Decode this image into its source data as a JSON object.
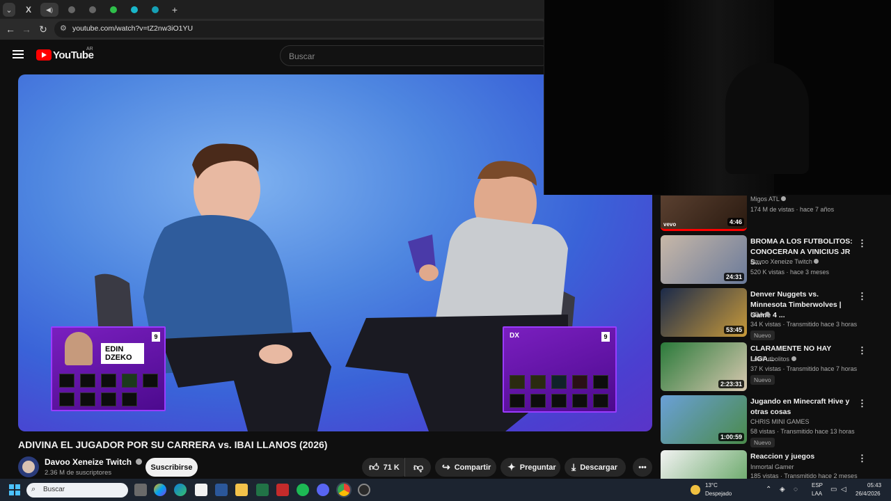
{
  "browser": {
    "tabs": [
      {
        "icon": "chevron-down-icon",
        "label": "⌄"
      },
      {
        "icon": "x-logo-icon",
        "label": "X"
      },
      {
        "icon": "speaker-icon",
        "label": "◀)"
      },
      {
        "icon": "globe-icon",
        "label": ""
      },
      {
        "icon": "globe-icon",
        "label": ""
      },
      {
        "icon": "extension-icon",
        "label": ""
      },
      {
        "icon": "tab-icon",
        "label": ""
      },
      {
        "icon": "tab-icon",
        "label": ""
      }
    ],
    "new_tab_label": "+",
    "url": "youtube.com/watch?v=tZ2nw3iO1YU"
  },
  "youtube": {
    "logo_text": "YouTube",
    "country": "AR",
    "search_placeholder": "Buscar"
  },
  "video": {
    "card_left": {
      "name_line1": "EDIN",
      "name_line2": "DZEKO",
      "score": "9"
    },
    "card_right": {
      "name": "DX",
      "score": "9"
    },
    "title": "ADIVINA EL JUGADOR POR SU CARRERA vs. IBAI LLANOS (2026)",
    "channel": "Davoo Xeneize Twitch",
    "subscribers": "2.36 M de suscriptores",
    "subscribe_label": "Suscribirse",
    "likes": "71 K",
    "share_label": "Compartir",
    "ask_label": "Preguntar",
    "download_label": "Descargar"
  },
  "related": [
    {
      "title": "",
      "channel": "Migos ATL",
      "verified": true,
      "meta": "174 M de vistas · hace 7 años",
      "duration": "4:46",
      "badge": ""
    },
    {
      "title": "BROMA A LOS FUTBOLITOS: CONOCERAN A VINICIUS JR S...",
      "channel": "Davoo Xeneize Twitch",
      "verified": true,
      "meta": "520 K vistas · hace 3 meses",
      "duration": "24:31",
      "badge": ""
    },
    {
      "title": "Denver Nuggets vs. Minnesota Timberwolves | Game 4 ...",
      "channel": "NBA",
      "verified": true,
      "meta": "34 K vistas · Transmitido hace 3 horas",
      "duration": "53:45",
      "badge": "Nuevo"
    },
    {
      "title": "CLARAMENTE NO HAY LIGA...",
      "channel": "Los Futbolitos",
      "verified": true,
      "meta": "37 K vistas · Transmitido hace 7 horas",
      "duration": "2:23:31",
      "badge": "Nuevo"
    },
    {
      "title": "Jugando en Minecraft Hive y otras cosas",
      "channel": "CHRIS MINI GAMES",
      "verified": false,
      "meta": "58 vistas · Transmitido hace 13 horas",
      "duration": "1:00:59",
      "badge": "Nuevo"
    },
    {
      "title": "Reaccion y juegos",
      "channel": "Inmortal Gamer",
      "verified": false,
      "meta": "185 vistas · Transmitido hace 2 meses",
      "duration": "",
      "badge": ""
    }
  ],
  "taskbar": {
    "search_placeholder": "Buscar",
    "weather_temp": "13°C",
    "weather_desc": "Despejado",
    "lang_line1": "ESP",
    "lang_line2": "LAA",
    "time": "05:43",
    "date": "26/4/2026"
  },
  "colors": {
    "yt_red": "#ff0000",
    "card_purple": "#7a1fbf",
    "background": "#0f0f0f"
  }
}
